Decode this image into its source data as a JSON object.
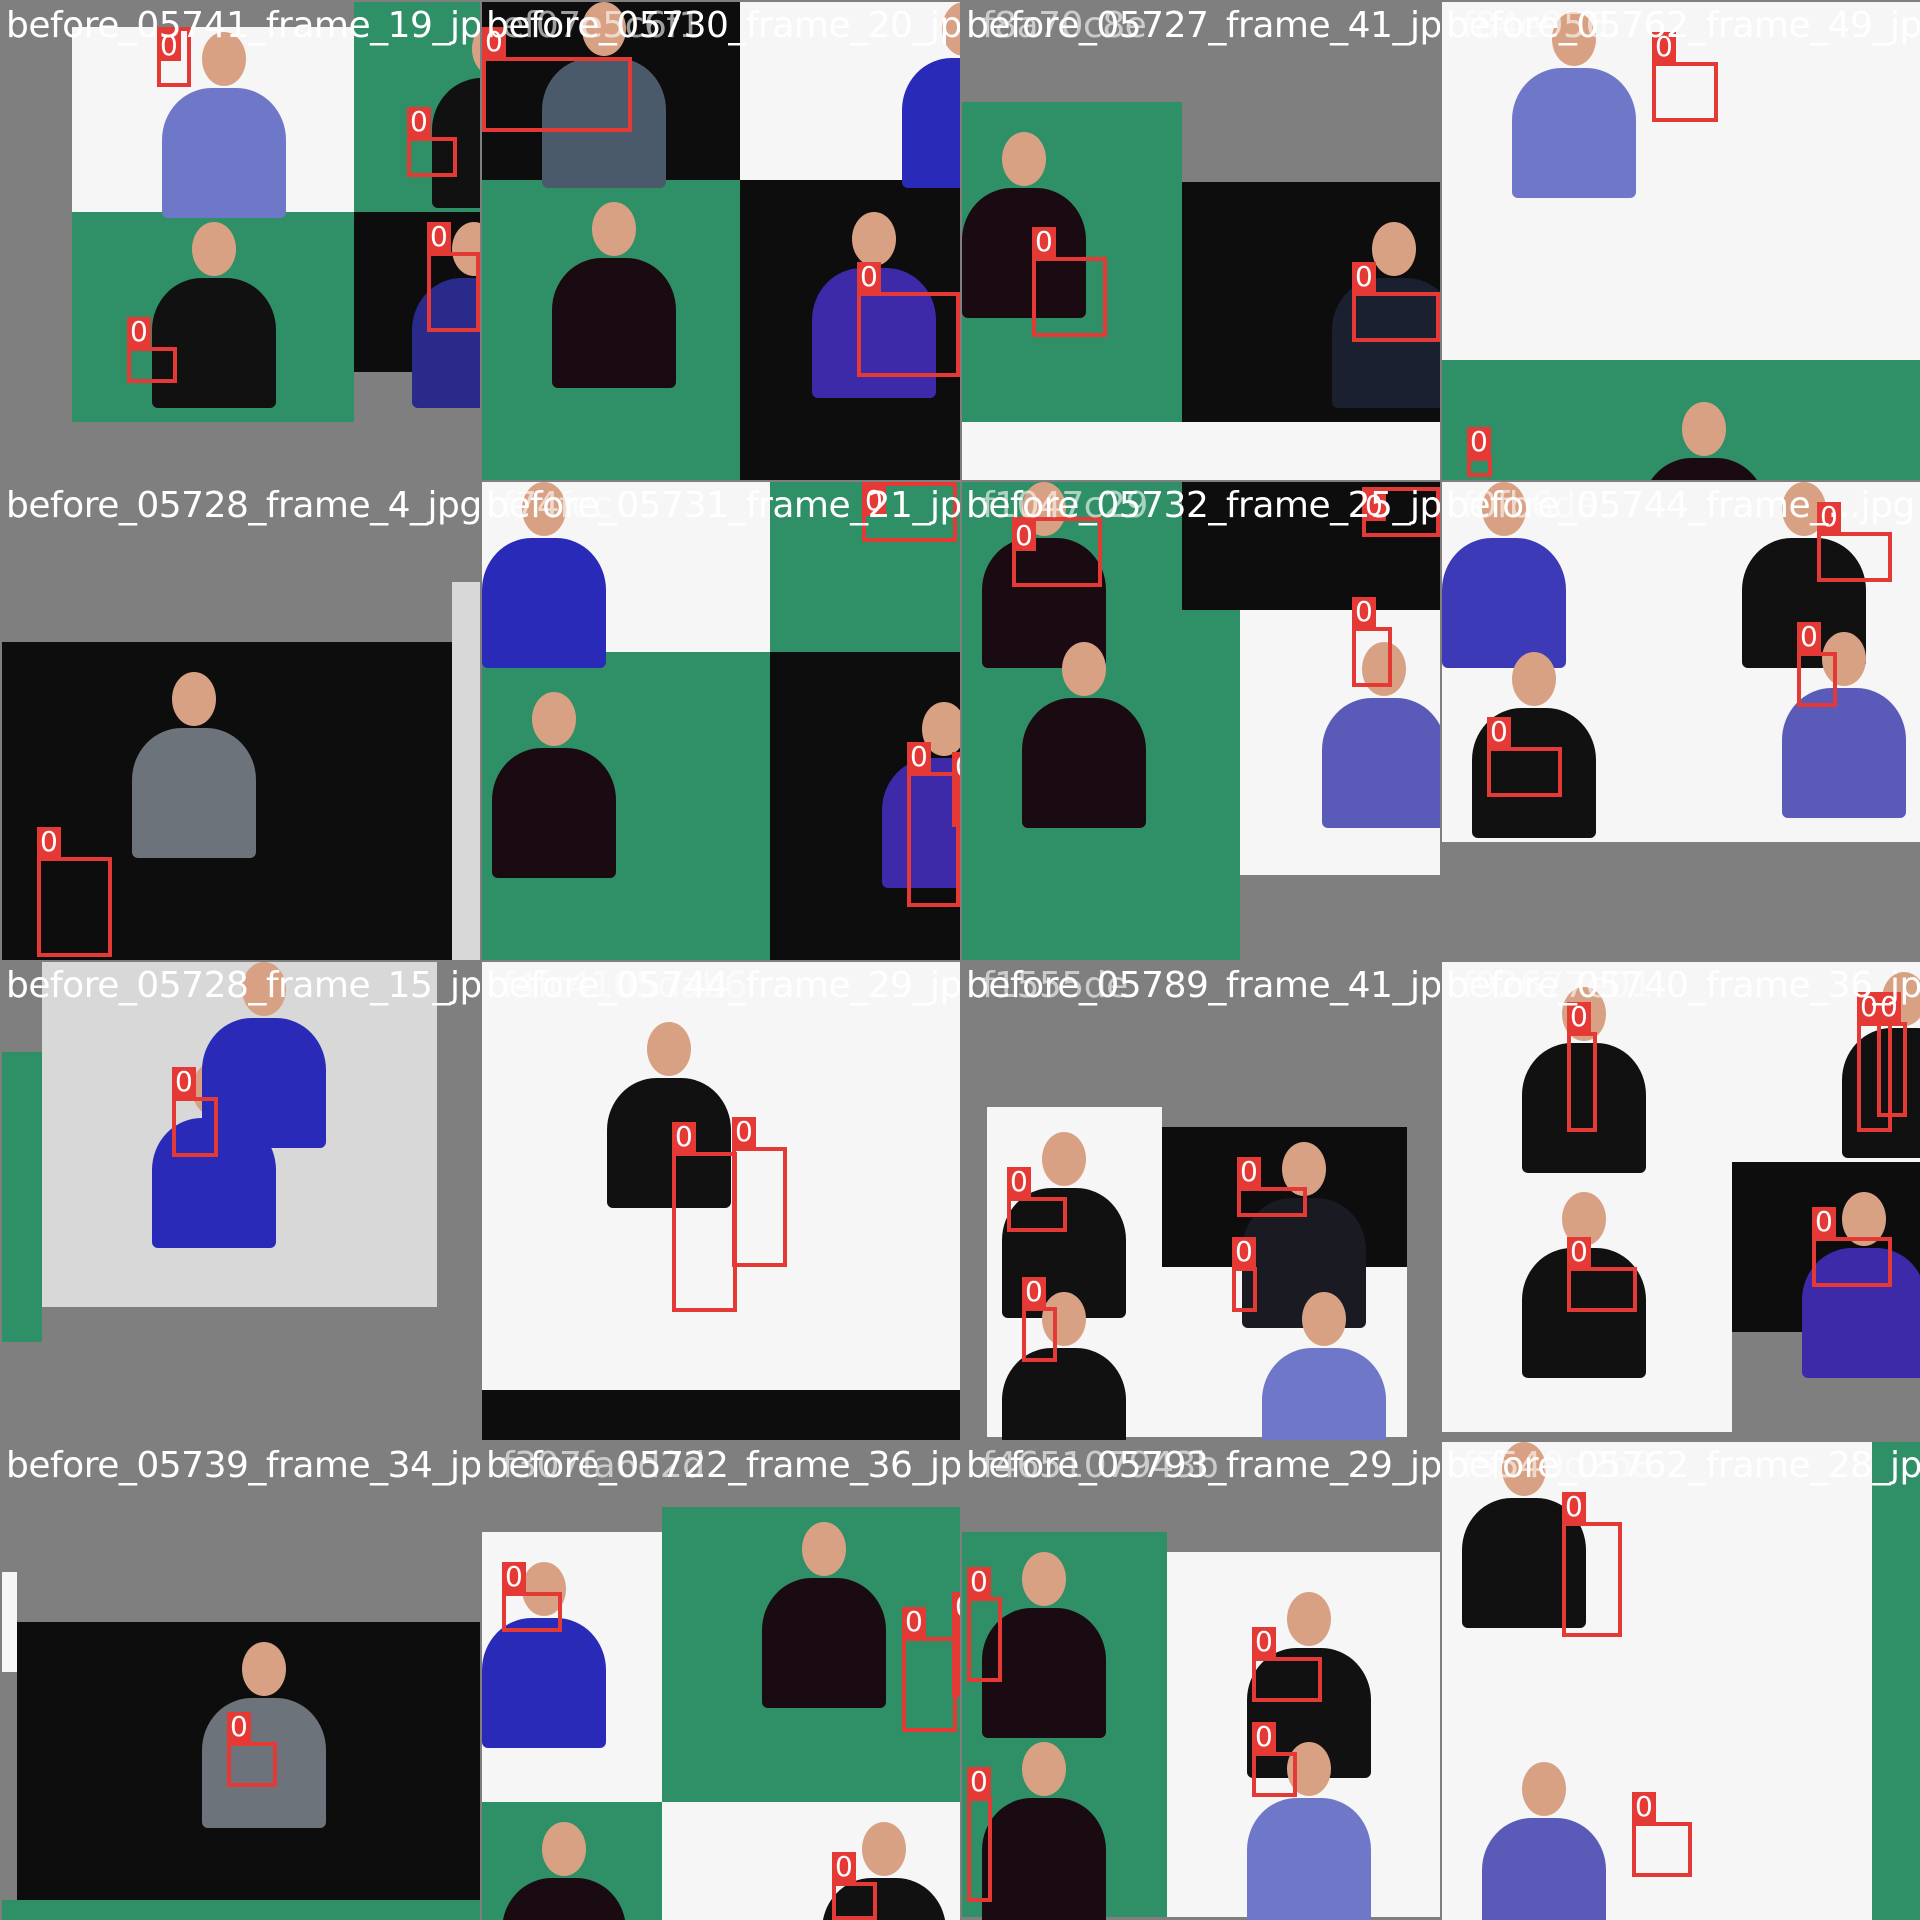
{
  "mosaic": {
    "tiles": [
      {
        "title": "before_05741_frame_19_jpg",
        "ghost_title": "",
        "box_count": 4
      },
      {
        "title": "before_05730_frame_20_jpg",
        "ghost_title": "ef07e5c6f1",
        "box_count": 2
      },
      {
        "title": "before_05727_frame_41_jpg",
        "ghost_title": "f8a70c8e",
        "box_count": 2
      },
      {
        "title": "before_05762_frame_49_jpg",
        "ghost_title": "f84e956",
        "box_count": 2
      },
      {
        "title": "before_05728_frame_4_jpg",
        "ghost_title": "",
        "box_count": 1
      },
      {
        "title": "before_05731_frame_21_jpg",
        "ghost_title": "f74fec",
        "box_count": 3
      },
      {
        "title": "before_05732_frame_25_jpg",
        "ghost_title": "f1047c29",
        "box_count": 3
      },
      {
        "title": "before_05744_frame_...jpg",
        "ghost_title": "f0fb6da",
        "box_count": 4
      },
      {
        "title": "before_05728_frame_15_jpg",
        "ghost_title": "",
        "box_count": 1
      },
      {
        "title": "before_05744_frame_29_jpg",
        "ghost_title": "f4fc4105dab6",
        "box_count": 2
      },
      {
        "title": "before_05789_frame_41_jpg",
        "ghost_title": "f1555de",
        "box_count": 4
      },
      {
        "title": "before_05740_frame_36_jpg",
        "ghost_title": "f92677e01",
        "box_count": 5
      },
      {
        "title": "before_05739_frame_34_jpg",
        "ghost_title": "",
        "box_count": 1
      },
      {
        "title": "before_05722_frame_36_jpg",
        "ghost_title": "f307fa6d2d",
        "box_count": 4
      },
      {
        "title": "before_05793_frame_29_jpg",
        "ghost_title": "f465107943b",
        "box_count": 5
      },
      {
        "title": "before_05762_frame_28_jpg",
        "ghost_title": "f5540d2b8",
        "box_count": 2
      }
    ],
    "class_label": "0",
    "box_color": "#e53935"
  }
}
